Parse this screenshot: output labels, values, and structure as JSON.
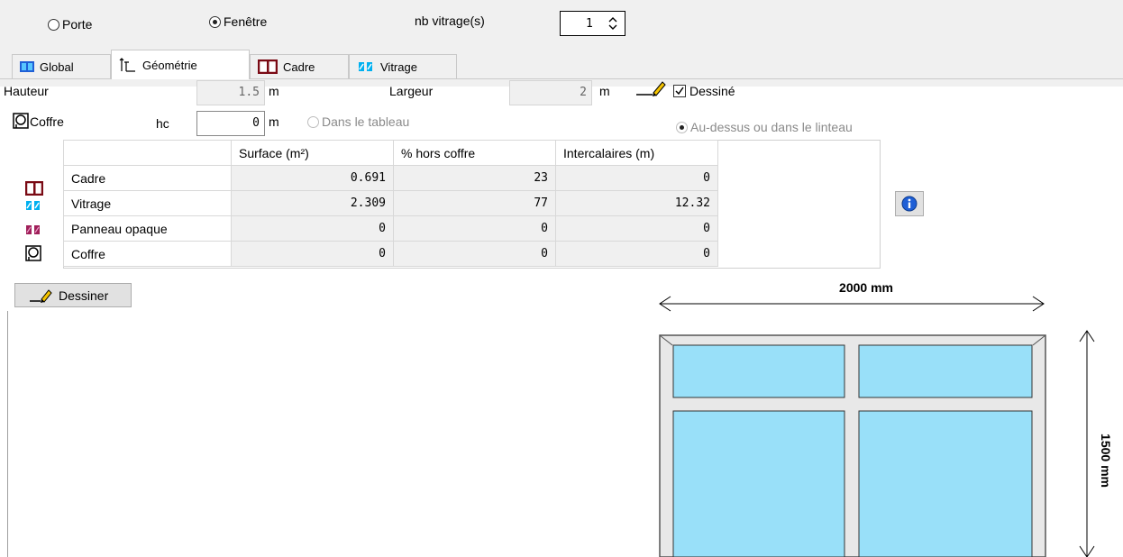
{
  "top": {
    "radio_porte": "Porte",
    "radio_fenetre": "Fenêtre",
    "nb_vitrage_label": "nb vitrage(s)",
    "nb_vitrage_value": "1",
    "selected": "fenetre"
  },
  "tabs": [
    {
      "label": "Global",
      "icon": "glazing-blue-icon"
    },
    {
      "label": "Géométrie",
      "icon": "dimension-icon",
      "active": true
    },
    {
      "label": "Cadre",
      "icon": "frame-icon"
    },
    {
      "label": "Vitrage",
      "icon": "glazing-cyan-icon"
    }
  ],
  "geometry": {
    "hauteur_label": "Hauteur",
    "hauteur_value": "1.5",
    "hauteur_unit": "m",
    "largeur_label": "Largeur",
    "largeur_value": "2",
    "largeur_unit": "m",
    "dessine_label": "Dessiné",
    "dessine_checked": true,
    "coffre_label": "Coffre",
    "hc_label": "hc",
    "hc_value": "0",
    "hc_unit": "m",
    "option_tableau": "Dans le tableau",
    "option_linteau": "Au-dessus ou dans le linteau"
  },
  "table": {
    "headers": [
      "",
      "Surface (m²)",
      "% hors coffre",
      "Intercalaires (m)"
    ],
    "rows": [
      {
        "name": "Cadre",
        "icon": "frame-icon",
        "surface": "0.691",
        "pct": "23",
        "inter": "0"
      },
      {
        "name": "Vitrage",
        "icon": "glazing-cyan-icon",
        "surface": "2.309",
        "pct": "77",
        "inter": "12.32"
      },
      {
        "name": "Panneau opaque",
        "icon": "opaque-panel-icon",
        "surface": "0",
        "pct": "0",
        "inter": "0"
      },
      {
        "name": "Coffre",
        "icon": "shutter-box-icon",
        "surface": "0",
        "pct": "0",
        "inter": "0"
      }
    ]
  },
  "drawing": {
    "button_label": "Dessiner",
    "width_label": "2000 mm",
    "height_label": "1500 mm",
    "frame_color": "#e8e8e8",
    "glass_color": "#99e0f9"
  },
  "colors": {
    "frame_icon": "#7a0a14",
    "glazing_cyan": "#00b0f0",
    "glazing_blue": "#1f5fd6",
    "opaque_panel": "#a0205a"
  }
}
